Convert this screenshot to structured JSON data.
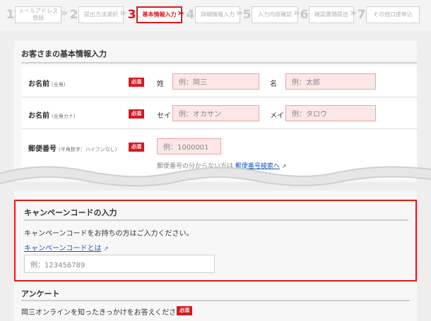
{
  "steps": [
    {
      "num": "1",
      "label_line1": "メールアドレス",
      "label_line2": "登録",
      "state": "done"
    },
    {
      "num": "2",
      "label_line1": "提出方法選択",
      "label_line2": "",
      "state": "done"
    },
    {
      "num": "3",
      "label_line1": "基本情報入力",
      "label_line2": "",
      "state": "active"
    },
    {
      "num": "4",
      "label_line1": "詳細情報入力",
      "label_line2": "",
      "state": "todo"
    },
    {
      "num": "5",
      "label_line1": "入力内容確認",
      "label_line2": "",
      "state": "todo"
    },
    {
      "num": "6",
      "label_line1": "確認書類提出",
      "label_line2": "",
      "state": "todo"
    },
    {
      "num": "7",
      "label_line1": "その他口座申込",
      "label_line2": "",
      "state": "todo"
    }
  ],
  "step_separator": "»",
  "basic_info": {
    "title": "お客さまの基本情報入力",
    "name_kanji": {
      "label": "お名前",
      "note": "(全角)",
      "required": "必須",
      "sei_label": "姓",
      "sei_placeholder": "例：岡三",
      "mei_label": "名",
      "mei_placeholder": "例：太郎"
    },
    "name_kana": {
      "label": "お名前",
      "note": "(全角カナ)",
      "required": "必須",
      "sei_label": "セイ",
      "sei_placeholder": "例：オカサン",
      "mei_label": "メイ",
      "mei_placeholder": "例：タロウ"
    },
    "postal": {
      "label": "郵便番号",
      "note": "(半角数字：ハイフンなし)",
      "required": "必須",
      "placeholder": "例：1000001",
      "hint_text": "郵便番号の分からない方は",
      "hint_link": "郵便番号検索へ"
    }
  },
  "campaign": {
    "title": "キャンペーンコードの入力",
    "description": "キャンペーンコードをお持ちの方はご入力ください。",
    "link": "キャンペーンコードとは",
    "placeholder": "例：123456789"
  },
  "survey": {
    "title": "アンケート",
    "question": "岡三オンラインを知ったきっかけをお答えください。",
    "required": "必須"
  },
  "colors": {
    "accent": "#d71920",
    "highlight_border": "#e01c1c",
    "link": "#1a56c4"
  },
  "icons": {
    "external_link": "↗"
  }
}
